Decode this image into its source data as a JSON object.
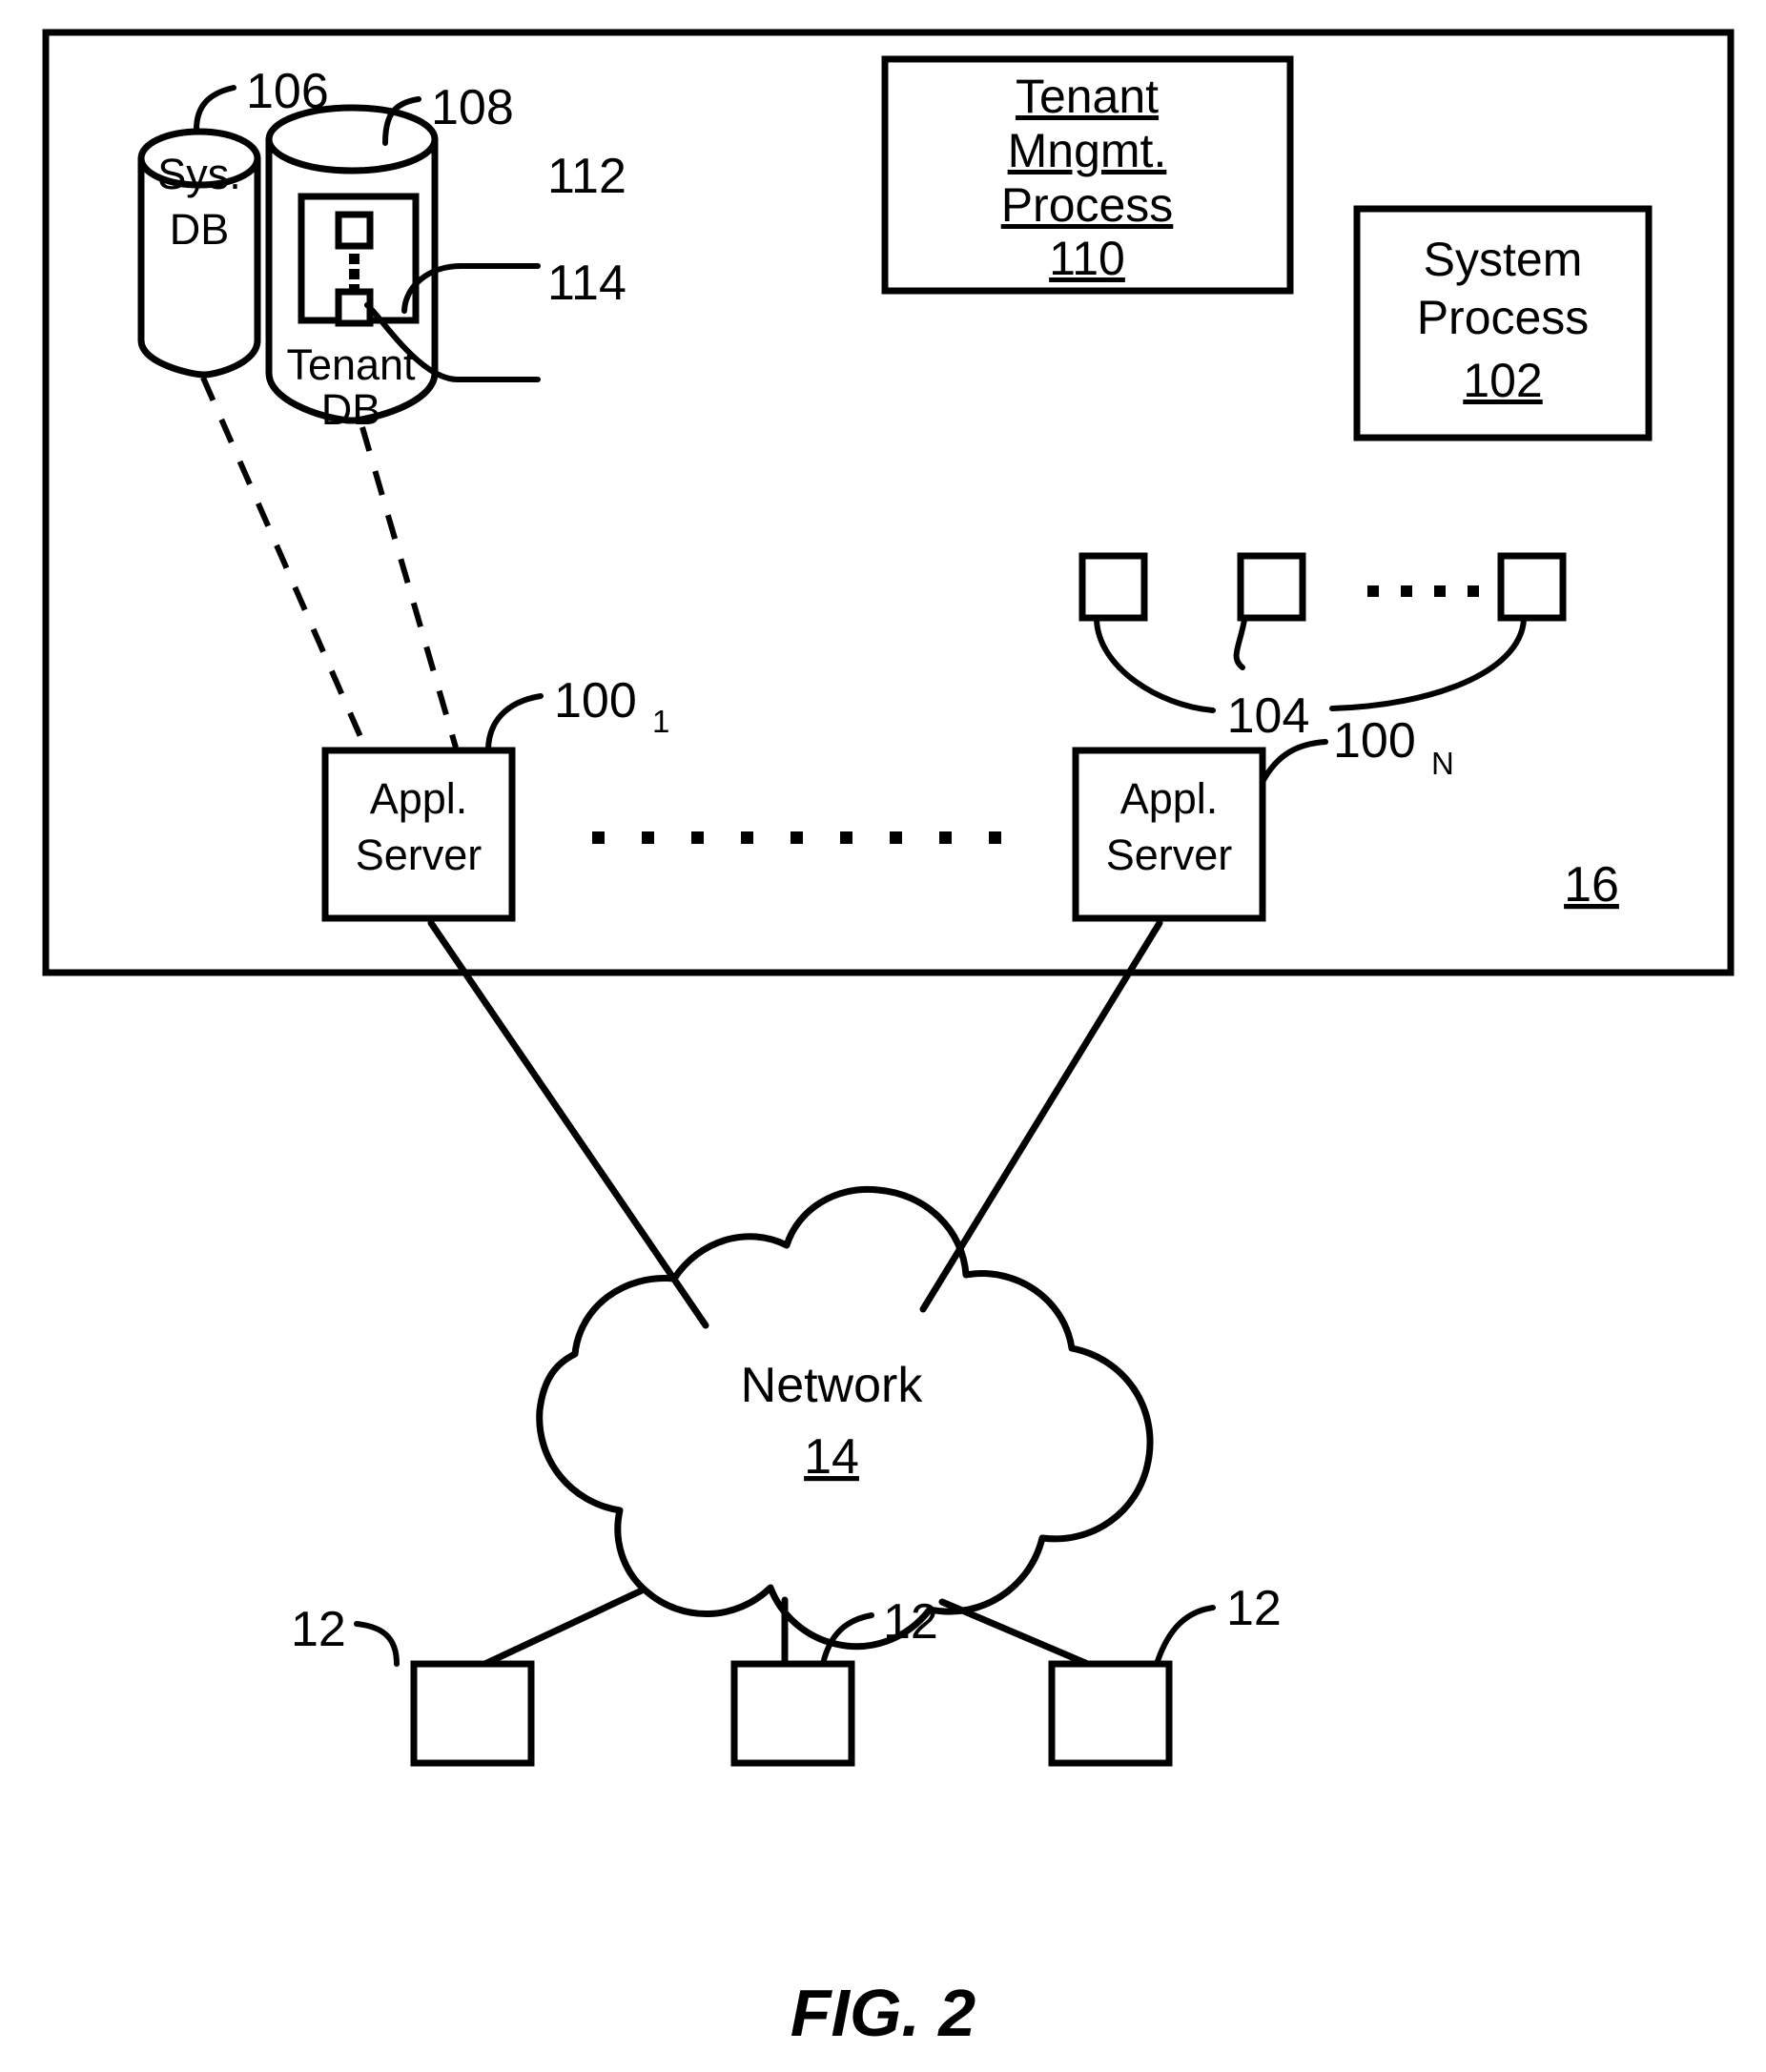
{
  "figure": {
    "caption": "FIG. 2",
    "system_ref": "16"
  },
  "databases": [
    {
      "name": "sys-db",
      "label_line1": "Sys.",
      "label_line2": "DB",
      "ref": "106"
    },
    {
      "name": "tenant-db",
      "label_line1": "Tenant",
      "label_line2": "DB",
      "ref": "108",
      "inner_refs": [
        {
          "ref": "112",
          "target": "tenant-storage-area"
        },
        {
          "ref": "114",
          "target": "tenant-data-item"
        }
      ]
    }
  ],
  "process_boxes": [
    {
      "name": "tenant-management-process",
      "lines": [
        "Tenant",
        "Mngmt.",
        "Process"
      ],
      "ref": "110"
    },
    {
      "name": "system-process",
      "lines": [
        "System",
        "Process"
      ],
      "ref": "102"
    }
  ],
  "tenant_storage": {
    "ref": "104",
    "item_count_visible": 3,
    "ellipsis": "...."
  },
  "app_servers": [
    {
      "name": "app-server-1",
      "line1": "Appl.",
      "line2": "Server",
      "ref": "100",
      "sub": "1"
    },
    {
      "name": "app-server-n",
      "line1": "Appl.",
      "line2": "Server",
      "ref": "100",
      "sub": "N"
    }
  ],
  "server_ellipsis": ". . . . . . . . . .",
  "network": {
    "name": "network-cloud",
    "label": "Network",
    "ref": "14"
  },
  "clients": [
    {
      "name": "client-1",
      "ref": "12"
    },
    {
      "name": "client-2",
      "ref": "12"
    },
    {
      "name": "client-3",
      "ref": "12"
    }
  ],
  "colors": {
    "line": "#000000",
    "fill": "#ffffff"
  }
}
